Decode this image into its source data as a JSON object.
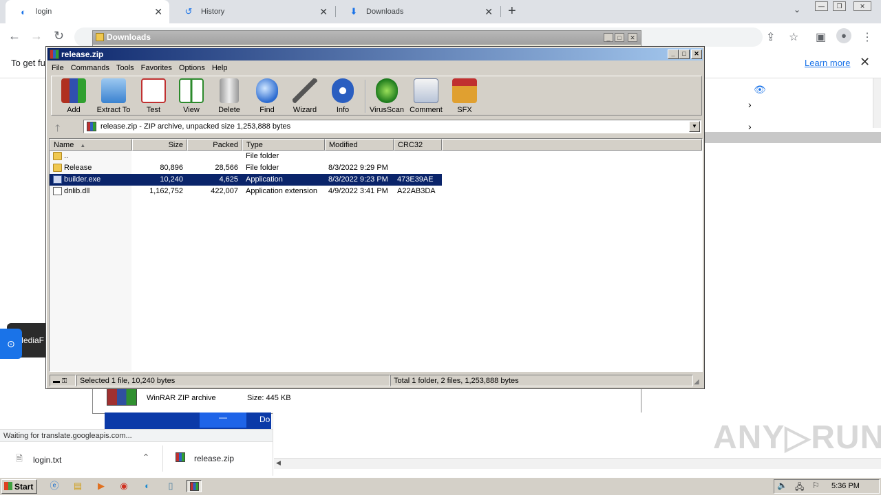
{
  "browser": {
    "tabs": [
      {
        "label": "login",
        "icon": "edge-like-icon"
      },
      {
        "label": "History",
        "icon": "history-icon"
      },
      {
        "label": "Downloads",
        "icon": "download-icon"
      }
    ],
    "translate_bar_text": "To get fu",
    "learn_more": "Learn more",
    "status_text": "Waiting for translate.googleapis.com...",
    "downloads_shelf": [
      {
        "name": "login.txt"
      },
      {
        "name": "release.zip"
      }
    ],
    "left_widget_text": "MediaF",
    "banner_partial": "Do"
  },
  "downloads_window": {
    "title": "Downloads",
    "archive_type": "WinRAR ZIP archive",
    "size": "Size: 445 KB"
  },
  "winrar": {
    "title": "release.zip",
    "menu": [
      "File",
      "Commands",
      "Tools",
      "Favorites",
      "Options",
      "Help"
    ],
    "toolbar": [
      {
        "label": "Add",
        "icon": "add-archive-icon"
      },
      {
        "label": "Extract To",
        "icon": "extract-folder-icon"
      },
      {
        "label": "Test",
        "icon": "test-clipboard-icon"
      },
      {
        "label": "View",
        "icon": "view-book-icon"
      },
      {
        "label": "Delete",
        "icon": "trash-icon"
      },
      {
        "label": "Find",
        "icon": "magnifier-icon"
      },
      {
        "label": "Wizard",
        "icon": "wand-icon"
      },
      {
        "label": "Info",
        "icon": "info-icon"
      },
      {
        "label": "VirusScan",
        "icon": "virus-icon"
      },
      {
        "label": "Comment",
        "icon": "comment-icon"
      },
      {
        "label": "SFX",
        "icon": "sfx-icon"
      }
    ],
    "path": "release.zip - ZIP archive, unpacked size 1,253,888 bytes",
    "columns": [
      "Name",
      "Size",
      "Packed",
      "Type",
      "Modified",
      "CRC32"
    ],
    "rows": [
      {
        "name": "..",
        "size": "",
        "packed": "",
        "type": "File folder",
        "modified": "",
        "crc": "",
        "kind": "folder"
      },
      {
        "name": "Release",
        "size": "80,896",
        "packed": "28,566",
        "type": "File folder",
        "modified": "8/3/2022 9:29 PM",
        "crc": "",
        "kind": "folder"
      },
      {
        "name": "builder.exe",
        "size": "10,240",
        "packed": "4,625",
        "type": "Application",
        "modified": "8/3/2022 9:23 PM",
        "crc": "473E39AE",
        "kind": "exe"
      },
      {
        "name": "dnlib.dll",
        "size": "1,162,752",
        "packed": "422,007",
        "type": "Application extension",
        "modified": "4/9/2022 3:41 PM",
        "crc": "A22AB3DA",
        "kind": "dll"
      }
    ],
    "status_left": "Selected 1 file, 10,240 bytes",
    "status_right": "Total 1 folder, 2 files, 1,253,888 bytes"
  },
  "taskbar": {
    "start": "Start",
    "clock": "5:36 PM"
  },
  "colors": {
    "selection": "#0a246a",
    "title_gradient_start": "#0a246a",
    "title_gradient_end": "#a6caf0",
    "chrome_link": "#1a73e8"
  }
}
